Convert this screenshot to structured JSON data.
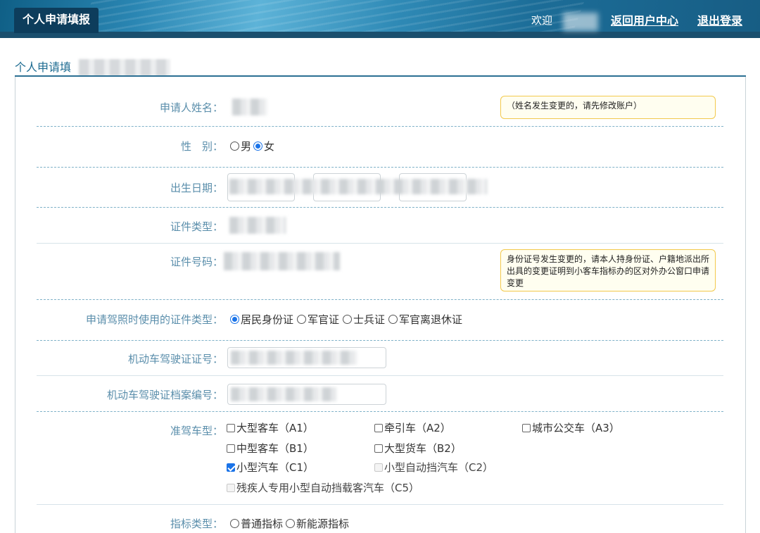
{
  "header": {
    "title": "个人申请填报",
    "welcome": "欢迎",
    "back_link": "返回用户中心",
    "logout_link": "退出登录"
  },
  "panel": {
    "title": "个人申请填"
  },
  "form": {
    "name_label": "申请人姓名：",
    "name_hint": "（姓名发生变更的，请先修改账户）",
    "gender_label": "性　别：",
    "gender_options": [
      "男",
      "女"
    ],
    "gender_selected": "女",
    "birth_label": "出生日期：",
    "id_type_label": "证件类型：",
    "id_number_label": "证件号码：",
    "id_number_hint": "身份证号发生变更的，请本人持身份证、户籍地派出所出具的变更证明到小客车指标办的区对外办公窗口申请变更",
    "license_id_type_label": "申请驾照时使用的证件类型：",
    "license_id_types": [
      "居民身份证",
      "军官证",
      "士兵证",
      "军官离退休证"
    ],
    "license_id_type_selected": "居民身份证",
    "license_no_label": "机动车驾驶证证号：",
    "license_file_label": "机动车驾驶证档案编号：",
    "vehicle_type_label": "准驾车型：",
    "vehicle_types": [
      {
        "label": "大型客车（A1）",
        "checked": false,
        "disabled": false
      },
      {
        "label": "牵引车（A2）",
        "checked": false,
        "disabled": false
      },
      {
        "label": "城市公交车（A3）",
        "checked": false,
        "disabled": false
      },
      {
        "label": "中型客车（B1）",
        "checked": false,
        "disabled": false
      },
      {
        "label": "大型货车（B2）",
        "checked": false,
        "disabled": false
      },
      {
        "label": "小型汽车（C1）",
        "checked": true,
        "disabled": false
      },
      {
        "label": "小型自动挡汽车（C2）",
        "checked": false,
        "disabled": true
      },
      {
        "label": "残疾人专用小型自动挡载客汽车（C5）",
        "checked": false,
        "disabled": true
      }
    ],
    "quota_type_label": "指标类型：",
    "quota_types": [
      "普通指标",
      "新能源指标"
    ]
  }
}
